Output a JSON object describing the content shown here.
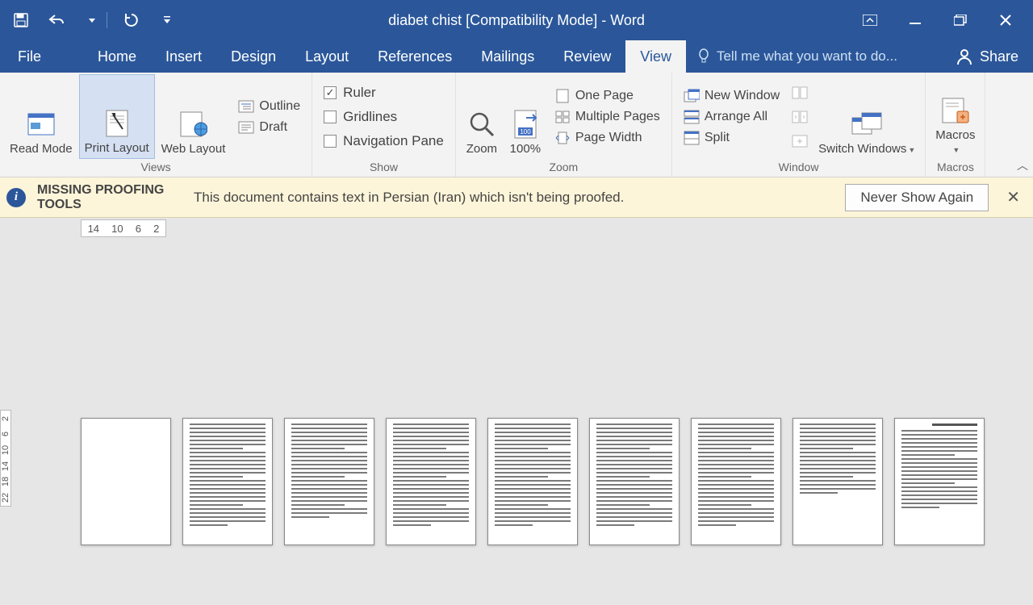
{
  "title": "diabet chist [Compatibility Mode] - Word",
  "tabs": {
    "file": "File",
    "home": "Home",
    "insert": "Insert",
    "design": "Design",
    "layout": "Layout",
    "references": "References",
    "mailings": "Mailings",
    "review": "Review",
    "view": "View"
  },
  "tellme": "Tell me what you want to do...",
  "share": "Share",
  "ribbon": {
    "views": {
      "read": "Read Mode",
      "print": "Print Layout",
      "web": "Web Layout",
      "outline": "Outline",
      "draft": "Draft",
      "label": "Views"
    },
    "show": {
      "ruler": "Ruler",
      "gridlines": "Gridlines",
      "nav": "Navigation Pane",
      "label": "Show"
    },
    "zoom": {
      "zoom": "Zoom",
      "hundred": "100%",
      "one": "One Page",
      "mult": "Multiple Pages",
      "width": "Page Width",
      "label": "Zoom"
    },
    "window": {
      "new": "New Window",
      "arr": "Arrange All",
      "split": "Split",
      "switch": "Switch Windows",
      "label": "Window"
    },
    "macros": {
      "macros": "Macros",
      "label": "Macros"
    }
  },
  "msg": {
    "title": "MISSING PROOFING TOOLS",
    "text": "This document contains text in Persian (Iran) which isn't being proofed.",
    "btn": "Never Show Again"
  },
  "ruler": {
    "h": [
      "14",
      "10",
      "6",
      "2"
    ],
    "v": [
      "2",
      "6",
      "10",
      "14",
      "18",
      "22"
    ]
  },
  "ruler_checked": true
}
